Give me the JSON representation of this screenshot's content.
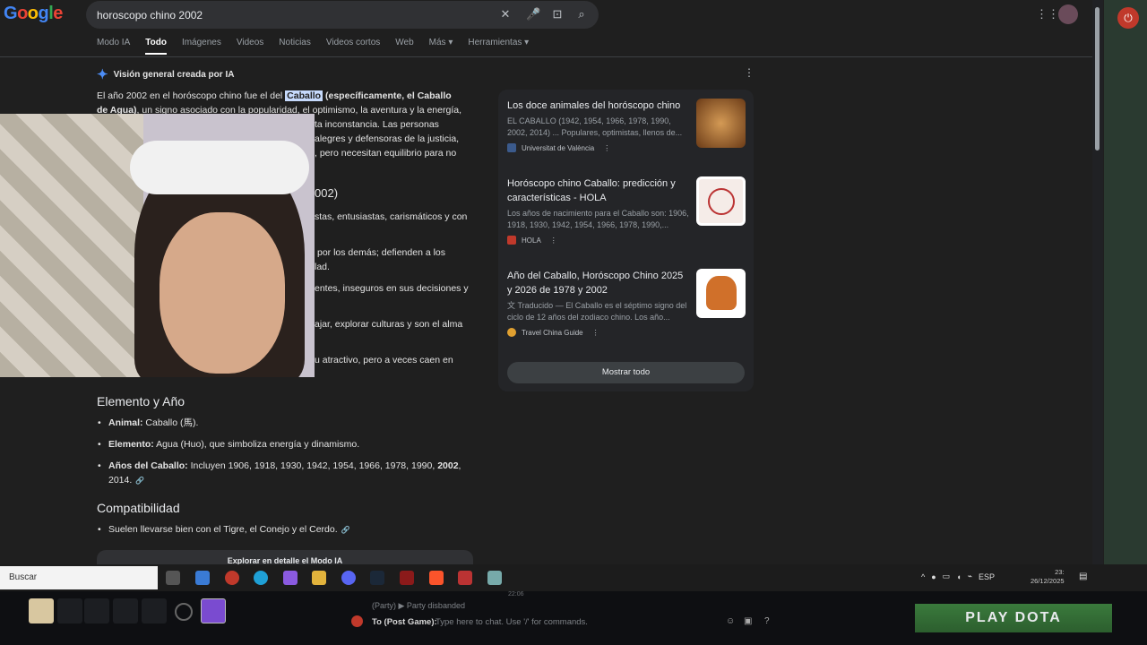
{
  "header": {
    "logo": "Google",
    "search_query": "horoscopo chino 2002",
    "tabs": [
      "Modo IA",
      "Todo",
      "Imágenes",
      "Videos",
      "Noticias",
      "Videos cortos",
      "Web",
      "Más ▾",
      "Herramientas ▾"
    ],
    "active_tab": "Todo"
  },
  "ai_overview": {
    "heading": "Visión general creada por IA",
    "intro_a": "El año 2002 en el horóscopo chino fue el del ",
    "intro_highlight": "Caballo",
    "intro_b": " (específicamente, el Caballo",
    "intro_c": "de Agua)",
    "intro_d": ", un signo asociado con la popularidad, el optimismo, la aventura y la energía,",
    "frag1": "ta inconstancia. Las personas",
    "frag2": "alegres y defensoras de la justicia,",
    "frag3": ", pero necesitan equilibrio para no",
    "frag4": "002)",
    "frag5": "stas, entusiastas, carismáticos y con",
    "frag6": "por los demás; defienden a los",
    "frag7": "lad.",
    "frag8": "entes, inseguros en sus decisiones y",
    "frag9": "ajar, explorar culturas y son el alma",
    "frag10": "u atractivo, pero a veces caen en",
    "section_element": "Elemento y Año",
    "bullets_element": [
      {
        "label": "Animal:",
        "text": " Caballo (馬)."
      },
      {
        "label": "Elemento:",
        "text": " Agua (Huo), que simboliza energía y dinamismo."
      },
      {
        "label": "Años del Caballo:",
        "text": " Incluyen 1906, 1918, 1930, 1942, 1954, 1966, 1978, 1990, ",
        "bold_tail": "2002",
        "tail": ",",
        "line2": "2014."
      }
    ],
    "section_compat": "Compatibilidad",
    "bullet_compat": "Suelen llevarse bien con el Tigre, el Conejo y el Cerdo.",
    "explore": "Explorar en detalle el Modo IA"
  },
  "sources": [
    {
      "title": "Los doce animales del horóscopo chino",
      "desc": "EL CABALLO (1942, 1954, 1966, 1978, 1990, 2002, 2014) ... Populares, optimistas, llenos de...",
      "site": "Universitat de València"
    },
    {
      "title": "Horóscopo chino Caballo: predicción y características - HOLA",
      "desc": "Los años de nacimiento para el Caballo son: 1906, 1918, 1930, 1942, 1954, 1966, 1978, 1990,...",
      "site": "HOLA"
    },
    {
      "title": "Año del Caballo, Horóscopo Chino 2025 y 2026 de 1978 y 2002",
      "desc": "文 Traducido — El Caballo es el séptimo signo del ciclo de 12 años del zodiaco chino. Los año...",
      "site": "Travel China Guide"
    }
  ],
  "show_all": "Mostrar todo",
  "taskbar": {
    "search": "Buscar",
    "lang": "ESP",
    "time": "23:",
    "date": "26/12/2025"
  },
  "dota": {
    "party": "(Party) ▶ Party disbanded",
    "chat_time": "22:06",
    "chat_prefix": "To (Post Game):",
    "chat_placeholder": "Type here to chat. Use '/' for commands.",
    "play_button": "PLAY DOTA"
  },
  "colors": {
    "accent": "#4c8df6",
    "highlight": "#c6dafc",
    "play": "#3a7a3c"
  }
}
